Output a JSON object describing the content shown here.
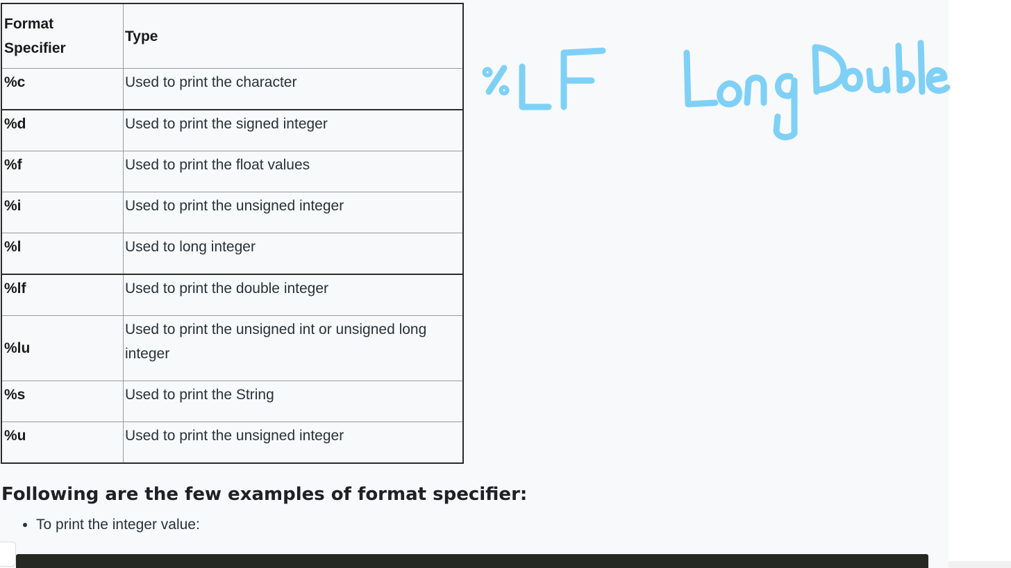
{
  "table": {
    "headers": [
      "Format\nSpecifier",
      "Type"
    ],
    "rows": [
      {
        "spec": "%c",
        "type": "Used to print the character"
      },
      {
        "spec": "%d",
        "type": "Used to print the signed integer"
      },
      {
        "spec": "%f",
        "type": "Used to print the float values"
      },
      {
        "spec": "%i",
        "type": "Used to print the unsigned integer"
      },
      {
        "spec": "%l",
        "type": "Used to long integer"
      },
      {
        "spec": "%lf",
        "type": "Used to print the double integer"
      },
      {
        "spec": "%lu",
        "type": "Used to print the unsigned int or unsigned long integer"
      },
      {
        "spec": "%s",
        "type": "Used to print the String"
      },
      {
        "spec": "%u",
        "type": "Used to print the unsigned integer"
      }
    ]
  },
  "annotation": {
    "left_text": "%LF",
    "right_text": "Long Double",
    "color": "#7fd0f7"
  },
  "section": {
    "heading": "Following are the few examples of format specifier:",
    "bullets": [
      "To print the integer value:"
    ]
  },
  "colors": {
    "page_background": "#f8f9fa",
    "code_block": "#262823"
  }
}
